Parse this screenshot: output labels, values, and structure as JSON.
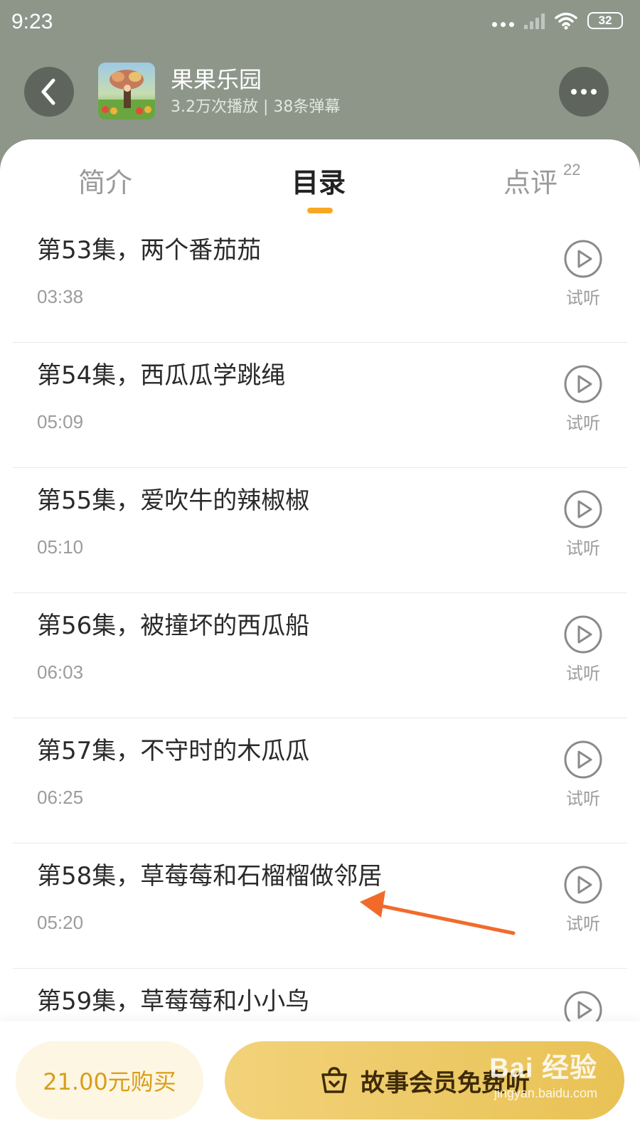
{
  "status_bar": {
    "time": "9:23",
    "battery": "32"
  },
  "header": {
    "album_title": "果果乐园",
    "album_subtitle": "3.2万次播放 | 38条弹幕"
  },
  "tabs": [
    {
      "label": "简介"
    },
    {
      "label": "目录",
      "active": true
    },
    {
      "label": "点评",
      "badge": "22"
    }
  ],
  "episodes": [
    {
      "title": "第53集，两个番茄茄",
      "duration": "03:38",
      "action": "试听"
    },
    {
      "title": "第54集，西瓜瓜学跳绳",
      "duration": "05:09",
      "action": "试听"
    },
    {
      "title": "第55集，爱吹牛的辣椒椒",
      "duration": "05:10",
      "action": "试听"
    },
    {
      "title": "第56集，被撞坏的西瓜船",
      "duration": "06:03",
      "action": "试听"
    },
    {
      "title": "第57集，不守时的木瓜瓜",
      "duration": "06:25",
      "action": "试听"
    },
    {
      "title": "第58集，草莓莓和石榴榴做邻居",
      "duration": "05:20",
      "action": "试听"
    },
    {
      "title": "第59集，草莓莓和小小鸟",
      "duration": "",
      "action": ""
    }
  ],
  "bottom_bar": {
    "buy_label": "21.00元购买",
    "member_label": "故事会员免费听"
  },
  "watermark": {
    "main": "Bai 经验",
    "sub": "jingyan.baidu.com"
  },
  "colors": {
    "accent": "#f7a823",
    "header_bg": "#8e968a",
    "gold": "#e9c255"
  }
}
